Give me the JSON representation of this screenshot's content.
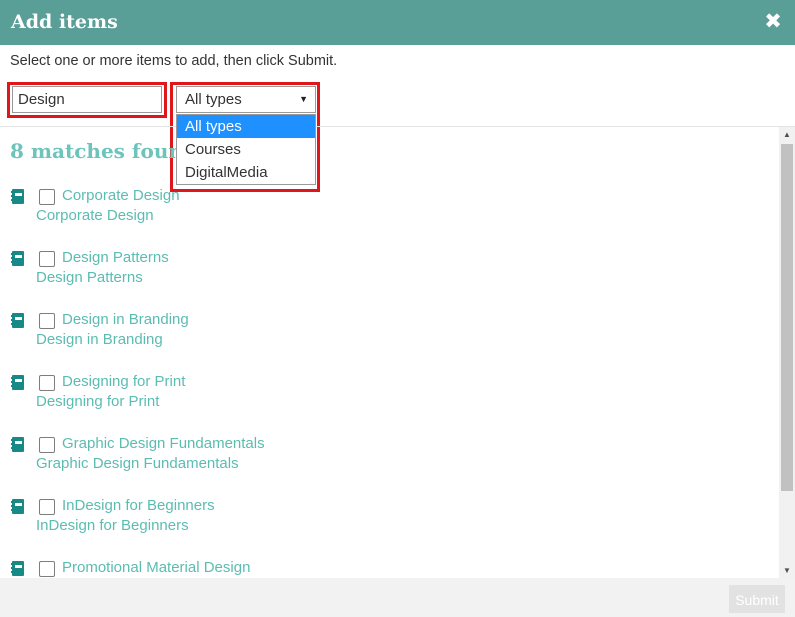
{
  "dialog": {
    "title": "Add items",
    "close_symbol": "✖",
    "instructions": "Select one or more items to add, then click Submit."
  },
  "filters": {
    "search_value": "Design",
    "type_select": {
      "selected": "All types",
      "options": [
        "All types",
        "Courses",
        "DigitalMedia"
      ],
      "highlighted_index": 0
    }
  },
  "results": {
    "heading": "8 matches found",
    "items": [
      {
        "title": "Corporate Design",
        "subtitle": "Corporate Design"
      },
      {
        "title": "Design Patterns",
        "subtitle": "Design Patterns"
      },
      {
        "title": "Design in Branding",
        "subtitle": "Design in Branding"
      },
      {
        "title": "Designing for Print",
        "subtitle": "Designing for Print"
      },
      {
        "title": "Graphic Design Fundamentals",
        "subtitle": "Graphic Design Fundamentals"
      },
      {
        "title": "InDesign for Beginners",
        "subtitle": "InDesign for Beginners"
      },
      {
        "title": "Promotional Material Design",
        "subtitle": ""
      }
    ],
    "item_icon": "book-icon"
  },
  "footer": {
    "submit_label": "Submit"
  },
  "colors": {
    "header_bg": "#5a9e98",
    "accent_text": "#5bbcb2",
    "highlight_border": "#e0161b",
    "selected_option_bg": "#1e90ff"
  }
}
